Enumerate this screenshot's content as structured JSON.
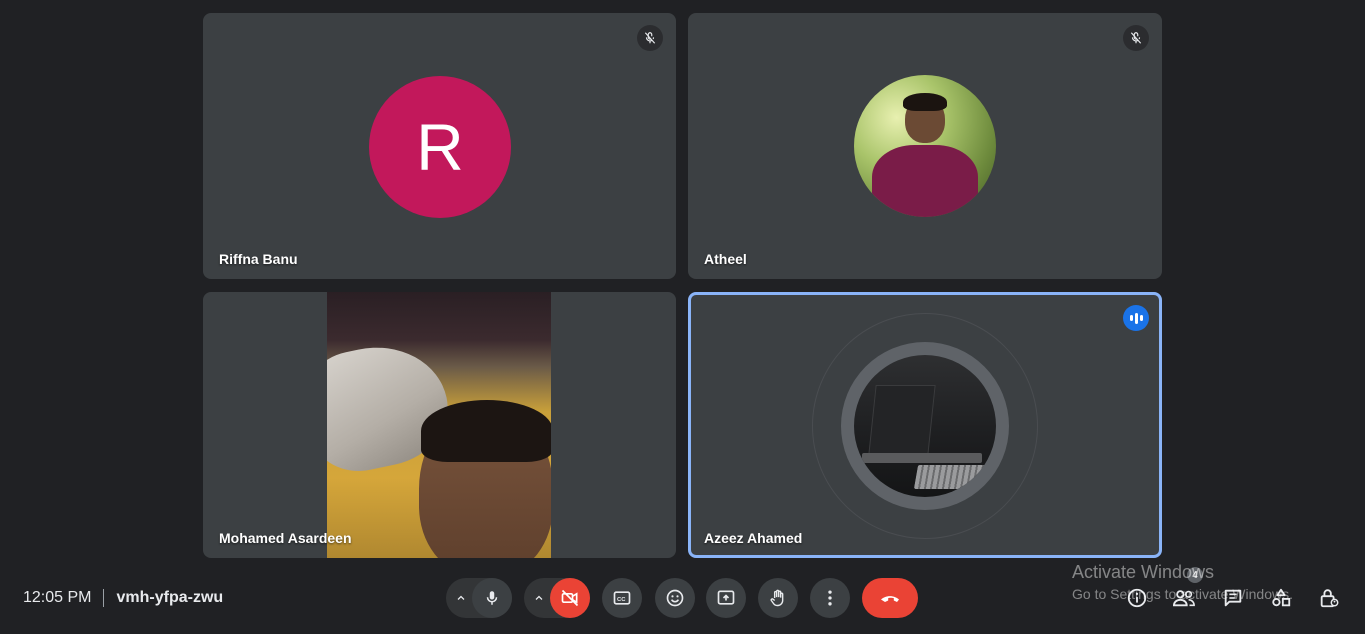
{
  "participants": [
    {
      "name": "Riffna Banu",
      "avatar_letter": "R",
      "avatar_color": "#c2185b",
      "muted": true
    },
    {
      "name": "Atheel",
      "muted": true
    },
    {
      "name": "Mohamed Asardeen",
      "video_on": true
    },
    {
      "name": "Azeez Ahamed",
      "speaking": true,
      "highlight_color": "#8ab4f8"
    }
  ],
  "footer": {
    "time": "12:05 PM",
    "meeting_code": "vmh-yfpa-zwu"
  },
  "controls": {
    "mic": "mic-icon",
    "camera": "camera-off-icon",
    "captions": "captions-icon",
    "reactions": "emoji-icon",
    "present": "present-icon",
    "raise_hand": "hand-icon",
    "more": "more-vert-icon",
    "end_call": "call-end-icon",
    "end_call_color": "#ea4335",
    "camera_off_color": "#ea4335"
  },
  "side_controls": {
    "people_count": "4"
  },
  "watermark": {
    "line1": "Activate Windows",
    "line2": "Go to Settings to activate Windows."
  }
}
